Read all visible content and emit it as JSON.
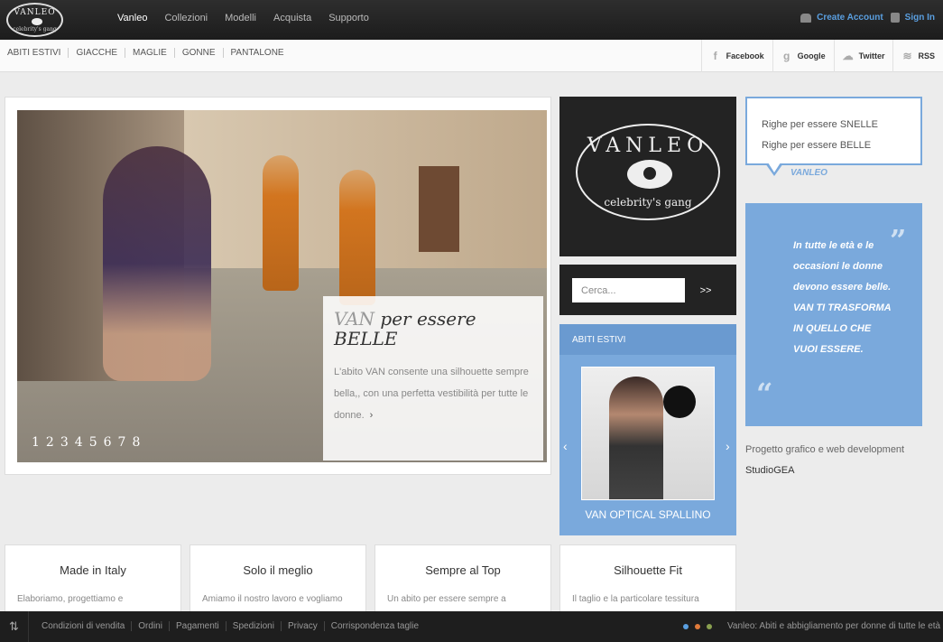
{
  "brand": {
    "logo_top": "VANLEO",
    "logo_bottom": "celebrity's gang"
  },
  "mainnav": {
    "items": [
      "Vanleo",
      "Collezioni",
      "Modelli",
      "Acquista",
      "Supporto"
    ]
  },
  "account": {
    "create": "Create Account",
    "signin": "Sign In"
  },
  "catnav": {
    "items": [
      "ABITI ESTIVI",
      "GIACCHE",
      "MAGLIE",
      "GONNE",
      "PANTALONE"
    ]
  },
  "social": {
    "items": [
      "Facebook",
      "Google",
      "Twitter",
      "RSS"
    ],
    "icons": [
      "facebook-icon",
      "google-icon",
      "twitter-icon",
      "rss-icon"
    ]
  },
  "slider": {
    "caption_van": "VAN",
    "caption_title_1": "per essere",
    "caption_title_2": "BELLE",
    "caption_text": "L'abito VAN consente una silhouette sempre bella,, con una perfetta vestibilità per tutte le donne.",
    "more_arrow": "›",
    "pages": [
      "1",
      "2",
      "3",
      "4",
      "5",
      "6",
      "7",
      "8"
    ]
  },
  "search": {
    "placeholder": "Cerca...",
    "button": ">>"
  },
  "abiti": {
    "header": "ABITI ESTIVI",
    "caption": "VAN OPTICAL SPALLINO",
    "prev": "‹",
    "next": "›"
  },
  "bubble": {
    "line1": "Righe per essere SNELLE",
    "line2": "Righe per essere BELLE",
    "author": "VANLEO"
  },
  "blue_quote": {
    "text": "In tutte le età e le occasioni le donne devono essere belle. VAN TI TRASFORMA IN QUELLO CHE VUOI ESSERE.",
    "open": "“",
    "close": "”"
  },
  "credit": {
    "label": "Progetto grafico e web development",
    "name": "StudioGEA"
  },
  "features": [
    {
      "title": "Made in Italy",
      "desc": "Elaboriamo, progettiamo e"
    },
    {
      "title": "Solo il meglio",
      "desc": "Amiamo il nostro lavoro e vogliamo"
    },
    {
      "title": "Sempre al Top",
      "desc": "Un abito per essere sempre a"
    },
    {
      "title": "Silhouette Fit",
      "desc": "Il taglio e la particolare tessitura"
    }
  ],
  "footer": {
    "links": [
      "Condizioni di vendita",
      "Ordini",
      "Pagamenti",
      "Spedizioni",
      "Privacy",
      "Corrispondenza taglie"
    ],
    "tagline": "Vanleo: Abiti e abbigliamento per donne di tutte le età",
    "dot_colors": [
      "#5a9fe0",
      "#e07a3a",
      "#8aa050"
    ]
  },
  "colors": {
    "accent": "#7aa9dc",
    "dark": "#232323"
  }
}
